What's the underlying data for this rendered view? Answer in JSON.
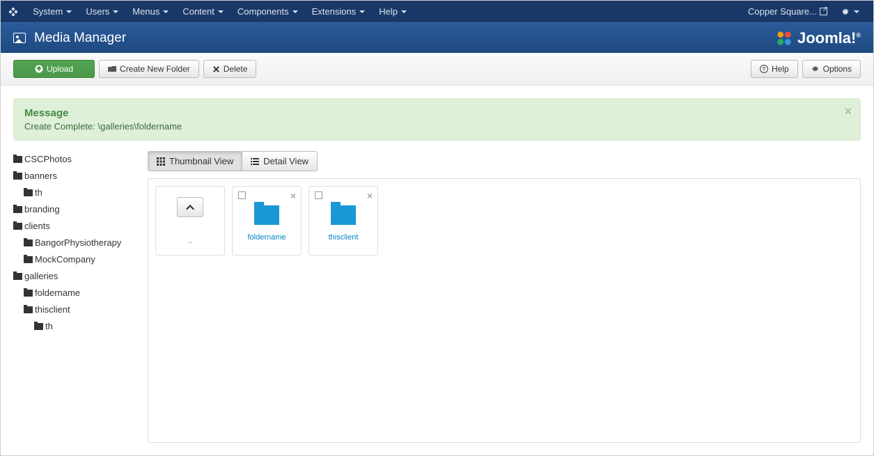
{
  "topnav": {
    "menu": [
      "System",
      "Users",
      "Menus",
      "Content",
      "Components",
      "Extensions",
      "Help"
    ],
    "site_name": "Copper Square..."
  },
  "header": {
    "title": "Media Manager",
    "brand": "Joomla!"
  },
  "toolbar": {
    "upload": "Upload",
    "create_folder": "Create New Folder",
    "delete": "Delete",
    "help": "Help",
    "options": "Options"
  },
  "alert": {
    "title": "Message",
    "body": "Create Complete: \\galleries\\foldername"
  },
  "sidebar": {
    "tree": [
      {
        "label": "CSCPhotos",
        "indent": 0
      },
      {
        "label": "banners",
        "indent": 0
      },
      {
        "label": "th",
        "indent": 1
      },
      {
        "label": "branding",
        "indent": 0
      },
      {
        "label": "clients",
        "indent": 0
      },
      {
        "label": "BangorPhysiotherapy",
        "indent": 1
      },
      {
        "label": "MockCompany",
        "indent": 1
      },
      {
        "label": "galleries",
        "indent": 0
      },
      {
        "label": "foldername",
        "indent": 1
      },
      {
        "label": "thisclient",
        "indent": 1
      },
      {
        "label": "th",
        "indent": 2
      }
    ]
  },
  "views": {
    "thumbnail": "Thumbnail View",
    "detail": "Detail View"
  },
  "media": {
    "up": "..",
    "items": [
      {
        "label": "foldername"
      },
      {
        "label": "thisclient"
      }
    ]
  }
}
